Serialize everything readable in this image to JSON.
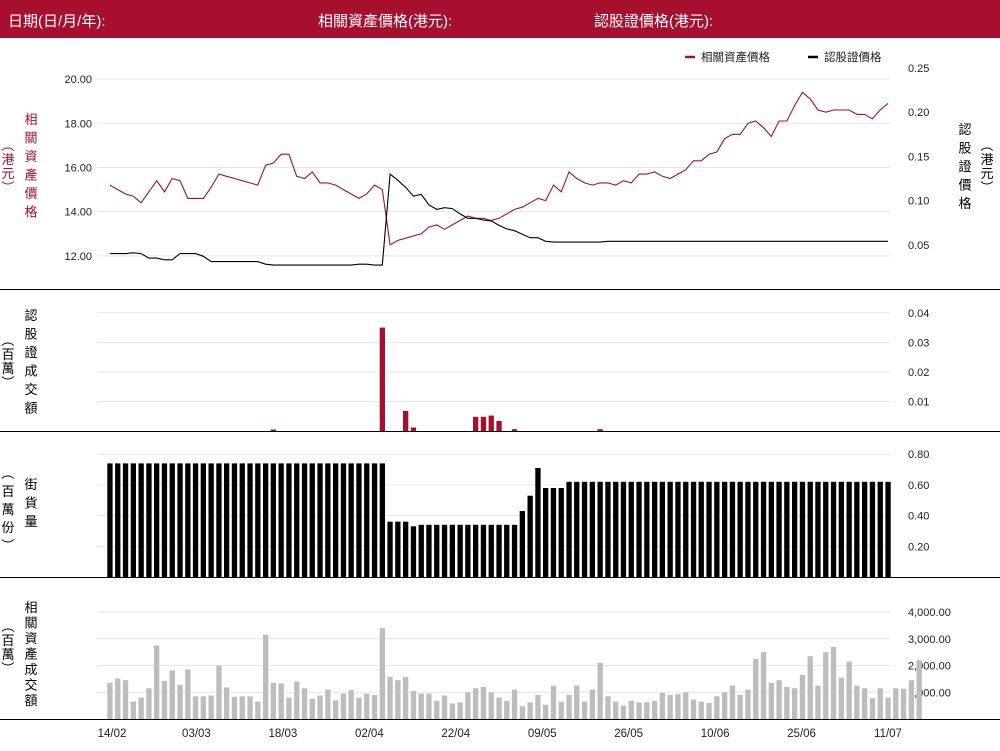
{
  "header": {
    "date_label": "日期(日/月/年):",
    "asset_price_label": "相關資產價格(港元):",
    "warrant_price_label": "認股證價格(港元):"
  },
  "colors": {
    "brand": "#a70f30",
    "warrant": "#000000",
    "asset_volume": "#bdbdbd"
  },
  "legend": {
    "asset": "相關資產價格",
    "warrant": "認股證價格"
  },
  "axis_titles": {
    "asset_price": "相關資產價格",
    "asset_price_unit": "（港元）",
    "warrant_price": "認股證價格",
    "warrant_price_unit": "（港元）",
    "warrant_turnover": "認股證成交額",
    "warrant_turnover_unit": "（百萬）",
    "outstanding": "街貨量",
    "outstanding_unit": "（百萬份）",
    "asset_turnover": "相關資產成交額",
    "asset_turnover_unit": "（百萬）"
  },
  "chart_data": [
    {
      "type": "line",
      "x_tick_labels": [
        "14/02",
        "03/03",
        "18/03",
        "02/04",
        "22/04",
        "09/05",
        "26/05",
        "10/06",
        "25/06",
        "11/07"
      ],
      "series": [
        {
          "name": "相關資產價格",
          "axis": "left",
          "values": [
            15.2,
            15.0,
            14.8,
            14.7,
            14.4,
            14.9,
            15.4,
            14.9,
            15.5,
            15.4,
            14.6,
            14.6,
            14.6,
            15.1,
            15.7,
            15.6,
            15.5,
            15.4,
            15.3,
            15.2,
            16.1,
            16.2,
            16.6,
            16.6,
            15.6,
            15.5,
            15.8,
            15.3,
            15.3,
            15.2,
            15.0,
            14.8,
            14.6,
            14.8,
            15.2,
            15.0,
            12.5,
            12.7,
            12.8,
            12.9,
            13.0,
            13.3,
            13.4,
            13.2,
            13.4,
            13.6,
            13.8,
            13.7,
            13.7,
            13.6,
            13.7,
            13.9,
            14.1,
            14.2,
            14.4,
            14.6,
            14.5,
            15.2,
            14.9,
            15.8,
            15.5,
            15.3,
            15.2,
            15.3,
            15.3,
            15.2,
            15.4,
            15.3,
            15.7,
            15.7,
            15.8,
            15.6,
            15.5,
            15.7,
            15.9,
            16.3,
            16.3,
            16.6,
            16.7,
            17.3,
            17.5,
            17.5,
            18.0,
            18.1,
            17.8,
            17.4,
            18.1,
            18.1,
            18.8,
            19.4,
            19.1,
            18.6,
            18.5,
            18.6,
            18.6,
            18.6,
            18.4,
            18.4,
            18.2,
            18.6,
            18.9
          ]
        },
        {
          "name": "認股證價格",
          "axis": "right",
          "values": [
            0.04,
            0.04,
            0.04,
            0.041,
            0.04,
            0.035,
            0.035,
            0.033,
            0.033,
            0.04,
            0.04,
            0.04,
            0.037,
            0.031,
            0.031,
            0.031,
            0.031,
            0.031,
            0.031,
            0.031,
            0.028,
            0.027,
            0.027,
            0.027,
            0.027,
            0.027,
            0.027,
            0.027,
            0.027,
            0.027,
            0.027,
            0.027,
            0.028,
            0.028,
            0.027,
            0.027,
            0.13,
            0.123,
            0.115,
            0.105,
            0.107,
            0.095,
            0.09,
            0.092,
            0.091,
            0.085,
            0.08,
            0.08,
            0.078,
            0.077,
            0.072,
            0.068,
            0.066,
            0.062,
            0.058,
            0.058,
            0.054,
            0.053,
            0.053,
            0.053,
            0.053,
            0.053,
            0.053,
            0.053,
            0.054,
            0.054,
            0.054,
            0.054,
            0.054,
            0.054,
            0.054,
            0.054,
            0.054,
            0.054,
            0.054,
            0.054,
            0.054,
            0.054,
            0.054,
            0.054,
            0.054,
            0.054,
            0.054,
            0.054,
            0.054,
            0.054,
            0.054,
            0.054,
            0.054,
            0.054,
            0.054,
            0.054,
            0.054,
            0.054,
            0.054,
            0.054,
            0.054,
            0.054,
            0.054,
            0.054,
            0.054
          ]
        }
      ],
      "y_left": {
        "range": [
          10.5,
          20.5
        ],
        "ticks": [
          "12.00",
          "14.00",
          "16.00",
          "18.00",
          "20.00"
        ]
      },
      "y_right": {
        "range": [
          0.0,
          0.25
        ],
        "ticks": [
          "0.05",
          "0.10",
          "0.15",
          "0.20",
          "0.25"
        ]
      },
      "legend_position": "top-right",
      "grid": true
    },
    {
      "type": "bar",
      "series": [
        {
          "values": [
            0,
            0,
            0,
            0,
            0,
            0,
            0,
            0,
            0,
            0,
            0,
            0,
            0,
            0,
            0,
            0,
            0,
            0,
            0,
            0,
            0,
            0.0005,
            0,
            0,
            0,
            0,
            0,
            0,
            0,
            0,
            0,
            0,
            0,
            0,
            0,
            0.035,
            0,
            0,
            0.0068,
            0.0012,
            0,
            0,
            0,
            0,
            0,
            0,
            0,
            0.0048,
            0.0048,
            0.0052,
            0.0034,
            0,
            0.0006,
            0,
            0,
            0,
            0,
            0,
            0,
            0,
            0,
            0,
            0,
            0.0006,
            0,
            0,
            0,
            0,
            0,
            0,
            0,
            0,
            0,
            0,
            0,
            0,
            0,
            0,
            0,
            0,
            0,
            0,
            0,
            0,
            0,
            0,
            0,
            0,
            0,
            0,
            0,
            0,
            0,
            0,
            0,
            0,
            0,
            0,
            0,
            0,
            0
          ]
        }
      ],
      "y_right": {
        "range": [
          0,
          0.045
        ],
        "ticks": [
          "0.01",
          "0.02",
          "0.03",
          "0.04"
        ]
      }
    },
    {
      "type": "bar",
      "series": [
        {
          "values": [
            0.74,
            0.74,
            0.74,
            0.74,
            0.74,
            0.74,
            0.74,
            0.74,
            0.74,
            0.74,
            0.74,
            0.74,
            0.74,
            0.74,
            0.74,
            0.74,
            0.74,
            0.74,
            0.74,
            0.74,
            0.74,
            0.74,
            0.74,
            0.74,
            0.74,
            0.74,
            0.74,
            0.74,
            0.74,
            0.74,
            0.74,
            0.74,
            0.74,
            0.74,
            0.74,
            0.74,
            0.36,
            0.36,
            0.36,
            0.33,
            0.34,
            0.34,
            0.34,
            0.34,
            0.34,
            0.34,
            0.34,
            0.34,
            0.34,
            0.34,
            0.34,
            0.34,
            0.34,
            0.43,
            0.53,
            0.71,
            0.58,
            0.58,
            0.58,
            0.62,
            0.62,
            0.62,
            0.62,
            0.62,
            0.62,
            0.62,
            0.62,
            0.62,
            0.62,
            0.62,
            0.62,
            0.62,
            0.62,
            0.62,
            0.62,
            0.62,
            0.62,
            0.62,
            0.62,
            0.62,
            0.62,
            0.62,
            0.62,
            0.62,
            0.62,
            0.62,
            0.62,
            0.62,
            0.62,
            0.62,
            0.62,
            0.62,
            0.62,
            0.62,
            0.62,
            0.62,
            0.62,
            0.62,
            0.62,
            0.62,
            0.62
          ]
        }
      ],
      "y_right": {
        "range": [
          0,
          0.86
        ],
        "ticks": [
          "0.20",
          "0.40",
          "0.60",
          "0.80"
        ]
      }
    },
    {
      "type": "bar",
      "series": [
        {
          "values": [
            1350,
            1520,
            1450,
            650,
            800,
            1150,
            2750,
            1420,
            1820,
            1280,
            1850,
            850,
            850,
            880,
            2000,
            1180,
            830,
            850,
            850,
            650,
            3150,
            1350,
            1330,
            800,
            1400,
            1150,
            750,
            880,
            1100,
            700,
            950,
            1080,
            800,
            950,
            900,
            3400,
            1580,
            1450,
            1580,
            1050,
            950,
            950,
            680,
            880,
            580,
            620,
            1000,
            1150,
            1200,
            1000,
            800,
            680,
            1100,
            480,
            620,
            900,
            530,
            1250,
            650,
            900,
            1250,
            650,
            1100,
            2100,
            850,
            650,
            500,
            680,
            620,
            630,
            680,
            980,
            900,
            930,
            1000,
            730,
            650,
            600,
            850,
            1000,
            1250,
            900,
            1100,
            2250,
            2500,
            1350,
            1450,
            1200,
            1150,
            1650,
            2350,
            1250,
            2500,
            2700,
            1550,
            2150,
            1250,
            1150,
            780,
            1150,
            800,
            1150,
            1130,
            1450,
            2200
          ]
        }
      ],
      "y_right": {
        "range": [
          0,
          4600
        ],
        "ticks": [
          "1,000.00",
          "2,000.00",
          "3,000.00",
          "4,000.00"
        ]
      }
    }
  ]
}
